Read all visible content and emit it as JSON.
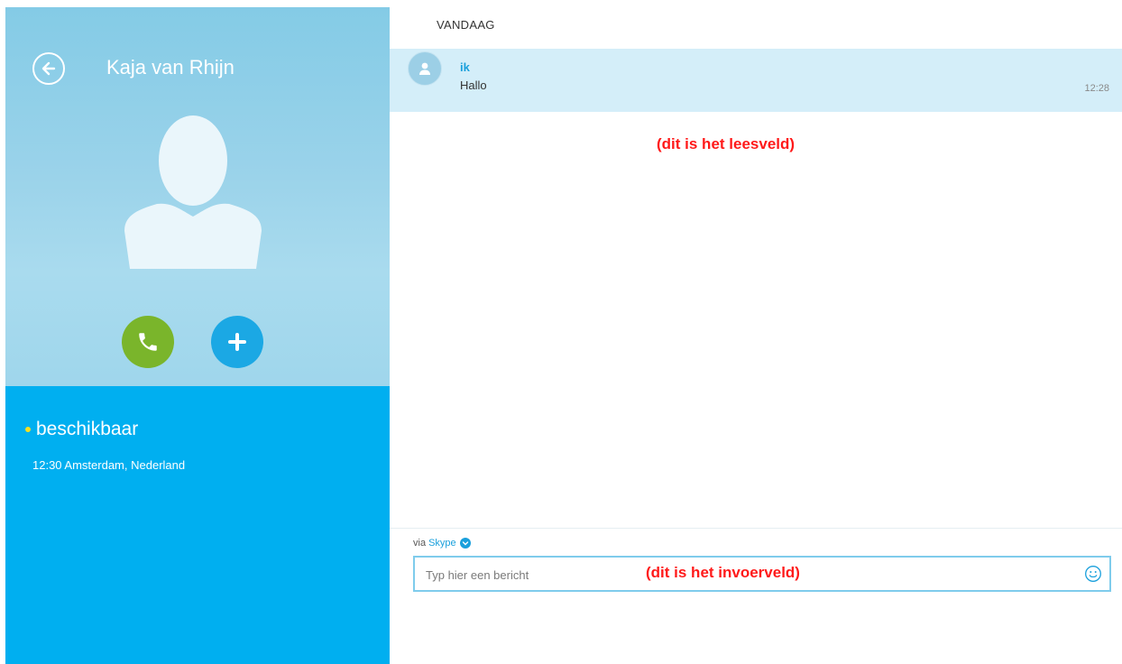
{
  "contact": {
    "name": "Kaja van Rhijn",
    "status": "beschikbaar",
    "location": "12:30 Amsterdam, Nederland"
  },
  "conversation": {
    "day_header": "VANDAAG",
    "messages": [
      {
        "sender": "ik",
        "text": "Hallo",
        "time": "12:28"
      }
    ],
    "read_annotation": "(dit is het leesveld)"
  },
  "composer": {
    "via_prefix": "via",
    "via_service": "Skype",
    "placeholder": "Typ hier een bericht",
    "input_annotation": "(dit is het invoerveld)"
  },
  "colors": {
    "status_blue": "#00aff0",
    "call_green": "#7ab52b",
    "add_blue": "#1ba8e4",
    "accent": "#1aa0dc",
    "annotation_red": "#ff1a1a",
    "status_dot": "#f4e01f"
  },
  "icons": {
    "back": "back-arrow-icon",
    "call": "phone-icon",
    "add": "plus-icon",
    "avatar": "person-icon",
    "emoji": "smiley-icon",
    "via_dropdown": "chevron-down-icon"
  }
}
